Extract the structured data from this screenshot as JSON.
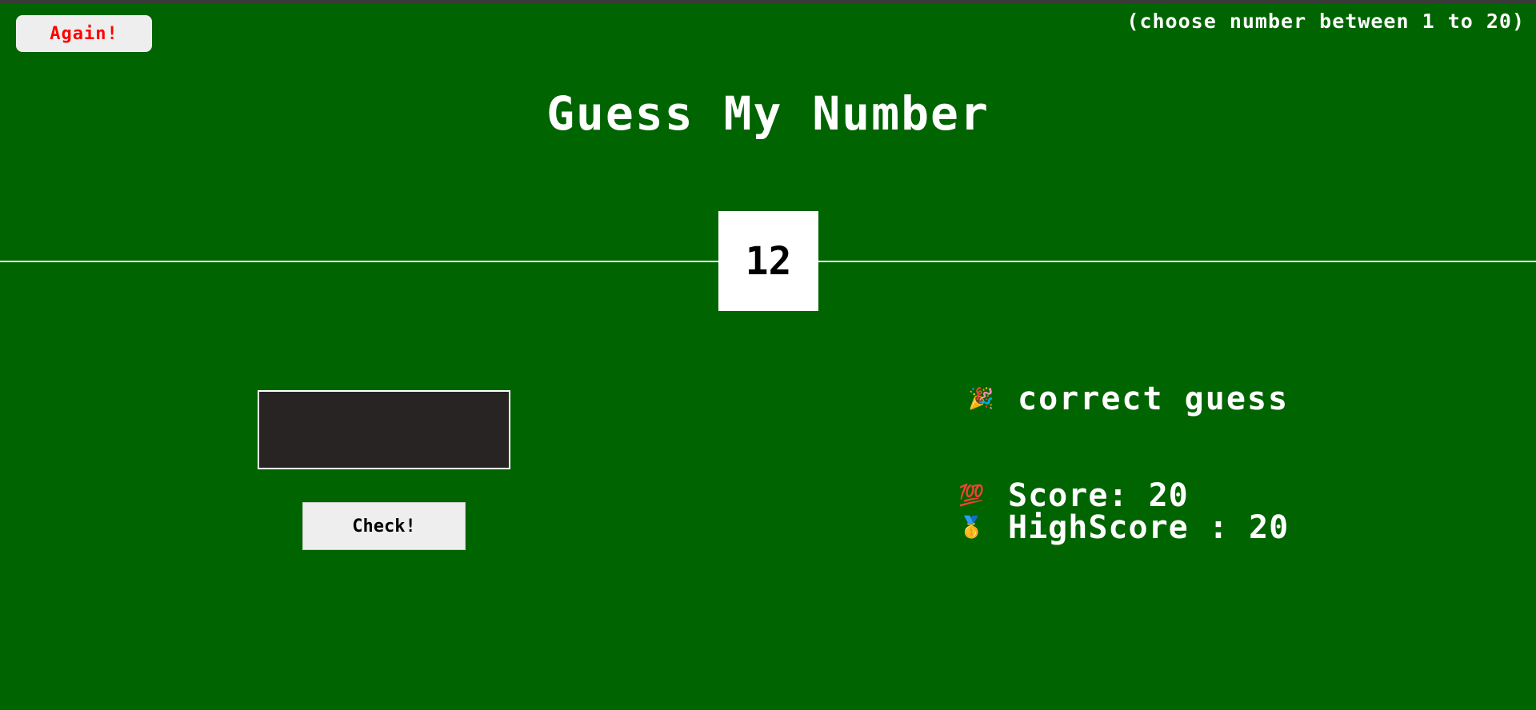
{
  "header": {
    "again_label": "Again!",
    "hint": "(choose number between 1 to 20)",
    "title": "Guess My Number"
  },
  "secret_number": "12",
  "input": {
    "value": "",
    "placeholder": ""
  },
  "check_label": "Check!",
  "message": {
    "icon": "party-popper-icon",
    "emoji": "🎉",
    "text": "correct guess"
  },
  "stats": {
    "score_icon": "hundred-points-icon",
    "score_emoji": "💯",
    "score_text": "Score: 20",
    "highscore_icon": "medal-icon",
    "highscore_emoji": "🥇",
    "highscore_text": "HighScore : 20"
  },
  "colors": {
    "background": "#006400",
    "again_text": "#ff0000",
    "input_background": "#282424"
  }
}
